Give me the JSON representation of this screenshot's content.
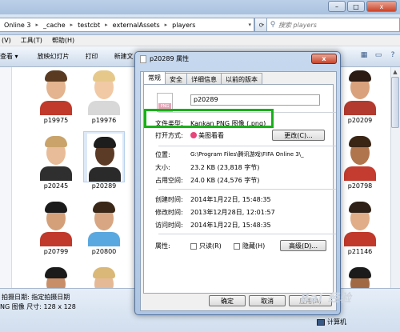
{
  "window": {
    "breadcrumb": [
      "Online 3",
      "_cache",
      "testcbt",
      "externalAssets",
      "players"
    ],
    "search_placeholder": "搜索 players",
    "controls": {
      "minimize": "–",
      "maximize": "□",
      "close": "x"
    }
  },
  "menubar": {
    "items": [
      "(V)",
      "工具(T)",
      "帮助(H)"
    ]
  },
  "toolbar": {
    "items": [
      "查看",
      "放映幻灯片",
      "打印",
      "新建文"
    ]
  },
  "thumbnails": [
    {
      "label": "p19975",
      "skin": "#e3b48f",
      "hair": "#5a3b22",
      "shirt": "#c0392b"
    },
    {
      "label": "p19976",
      "skin": "#f1c9a5",
      "hair": "#e6c98a",
      "shirt": "#d8d8d8"
    },
    {
      "label": "p20209",
      "skin": "#d9a27c",
      "hair": "#2b1b12",
      "shirt": "#b23a2e"
    },
    {
      "label": "p20245",
      "skin": "#e8bc98",
      "hair": "#c9a36a",
      "shirt": "#2f2f2f"
    },
    {
      "label": "p20289",
      "skin": "#5b3a26",
      "hair": "#1d1d1d",
      "shirt": "#2a2a2a"
    },
    {
      "label": "p20798",
      "skin": "#b0754d",
      "hair": "#3a2414",
      "shirt": "#c43b2f"
    },
    {
      "label": "p20799",
      "skin": "#d4a07a",
      "hair": "#1b1b1b",
      "shirt": "#c0392b"
    },
    {
      "label": "p20800",
      "skin": "#d8a682",
      "hair": "#3a2717",
      "shirt": "#5aa8e0"
    },
    {
      "label": "p21146",
      "skin": "#e0ad88",
      "hair": "#2e2016",
      "shirt": "#c0392b"
    },
    {
      "label": "",
      "skin": "#c88e68",
      "hair": "#1b1b1b",
      "shirt": "#c0392b"
    },
    {
      "label": "",
      "skin": "#e5b995",
      "hair": "#d9b878",
      "shirt": "#3b6fb5"
    },
    {
      "label": "",
      "skin": "#a16a45",
      "hair": "#1b1b1b",
      "shirt": "#c0392b"
    }
  ],
  "status": {
    "line1": "拍摄日期: 指定拍摄日期",
    "line2": "NG 图像    尺寸: 128 x 128",
    "computer": "计算机"
  },
  "dialog": {
    "title": "p20289 属性",
    "close": "x",
    "tabs": [
      "常规",
      "安全",
      "详细信息",
      "以前的版本"
    ],
    "filename": "p20289",
    "file_badge": "PNG",
    "rows": {
      "type_label": "文件类型:",
      "type_value": "Kankan PNG 图像 (.png)",
      "open_label": "打开方式:",
      "open_value": "美图看看",
      "change_button": "更改(C)...",
      "location_label": "位置:",
      "location_value": "G:\\Program Files\\腾讯游戏\\FIFA Online 3\\_",
      "size_label": "大小:",
      "size_value": "23.2 KB (23,818 字节)",
      "disk_label": "占用空间:",
      "disk_value": "24.0 KB (24,576 字节)",
      "created_label": "创建时间:",
      "created_value": "2014年1月22日, 15:48:35",
      "modified_label": "修改时间:",
      "modified_value": "2013年12月28日, 12:01:57",
      "accessed_label": "访问时间:",
      "accessed_value": "2014年1月22日, 15:48:35",
      "attr_label": "属性:",
      "readonly": "只读(R)",
      "hidden": "隐藏(H)",
      "advanced": "高级(D)..."
    },
    "buttons": {
      "ok": "确定",
      "cancel": "取消",
      "apply": "应用(A)"
    }
  },
  "watermark": "Bai 经验",
  "colors": {
    "highlight": "#19b019",
    "accent": "#3a5a86"
  }
}
